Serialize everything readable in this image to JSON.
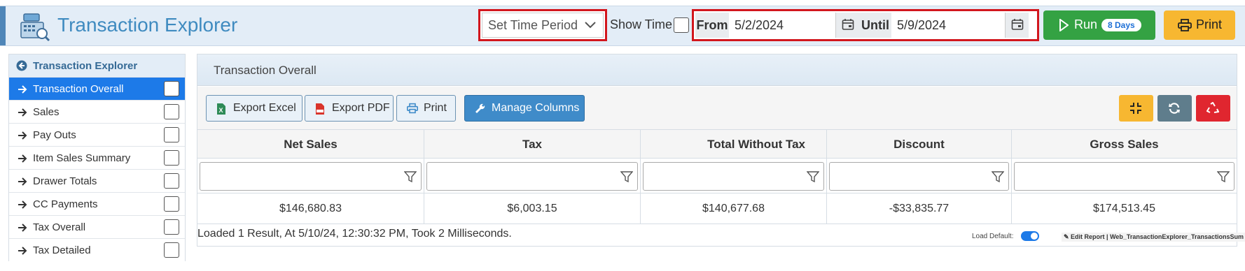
{
  "header": {
    "title": "Transaction Explorer",
    "time_period": "Set Time Period",
    "show_time_label": "Show Time",
    "from_label": "From",
    "from_value": "5/2/2024",
    "until_label": "Until",
    "until_value": "5/9/2024",
    "run_label": "Run",
    "run_badge": "8 Days",
    "print_label": "Print"
  },
  "sidebar": {
    "title": "Transaction Explorer",
    "items": [
      {
        "label": "Transaction Overall",
        "active": true
      },
      {
        "label": "Sales"
      },
      {
        "label": "Pay Outs"
      },
      {
        "label": "Item Sales Summary"
      },
      {
        "label": "Drawer Totals"
      },
      {
        "label": "CC Payments"
      },
      {
        "label": "Tax Overall"
      },
      {
        "label": "Tax Detailed"
      }
    ]
  },
  "main": {
    "panel_title": "Transaction Overall",
    "toolbar": {
      "export_excel": "Export Excel",
      "export_pdf": "Export PDF",
      "print": "Print",
      "manage_columns": "Manage Columns"
    },
    "columns": [
      "Net Sales",
      "Tax",
      "Total Without Tax",
      "Discount",
      "Gross Sales"
    ],
    "row": [
      "$146,680.83",
      "$6,003.15",
      "$140,677.68",
      "-$33,835.77",
      "$174,513.45"
    ],
    "status": "Loaded 1 Result, At 5/10/24, 12:30:32 PM, Took 2 Milliseconds.",
    "load_default_label": "Load Default:",
    "edit_report": "Edit Report | Web_TransactionExplorer_TransactionsSum"
  },
  "colors": {
    "accent": "#3f8bc0",
    "highlight_border": "#d2161d",
    "run_green": "#34a243",
    "print_yellow": "#f7b731",
    "active_blue": "#1d7ae8",
    "danger_red": "#e0262f",
    "grey_button": "#5f7d8c"
  }
}
